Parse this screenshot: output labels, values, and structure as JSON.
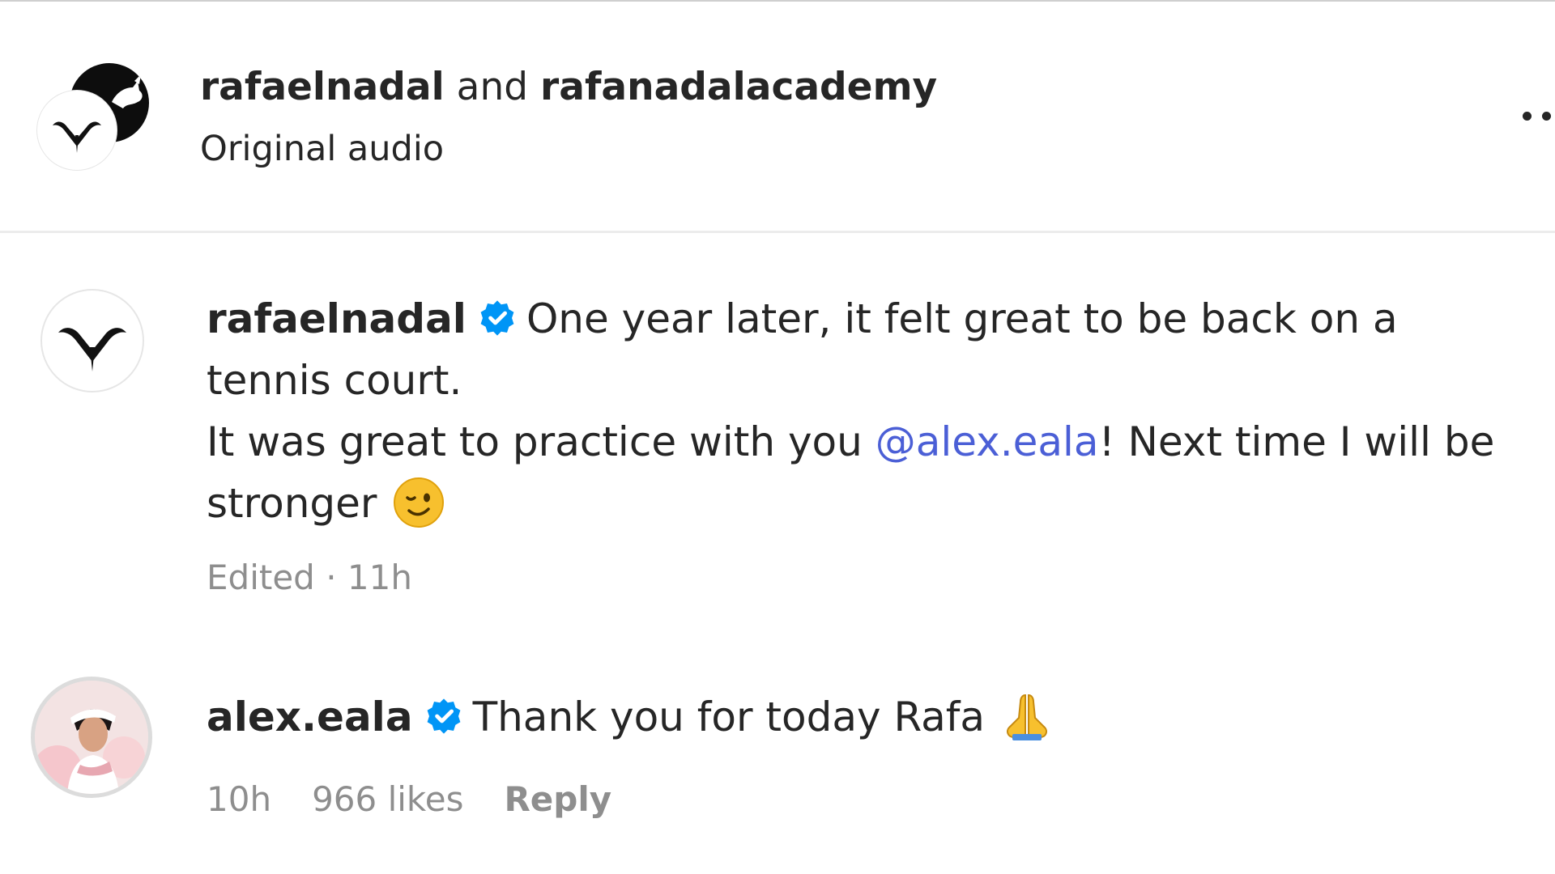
{
  "header": {
    "author_primary": "rafaelnadal",
    "joiner": "and",
    "author_secondary": "rafanadalacademy",
    "audio_label": "Original audio",
    "more_icon": "more-horizontal-icon"
  },
  "comments": [
    {
      "username": "rafaelnadal",
      "verified": true,
      "text_part1": "One year later, it felt great to be back on a tennis court.",
      "text_part2": "It was great to practice with you ",
      "mention": "@alex.eala",
      "text_part3": "! Next time I will be stronger",
      "emoji_icon": "winking-face-emoji",
      "edited_label": "Edited",
      "separator": "·",
      "time": "11h"
    },
    {
      "username": "alex.eala",
      "verified": true,
      "text": "Thank you for today Rafa",
      "emoji_icon": "folded-hands-emoji",
      "time": "10h",
      "likes": "966 likes",
      "reply_label": "Reply"
    }
  ],
  "colors": {
    "text": "#262626",
    "muted": "#8e8e8e",
    "mention": "#4b5fd6",
    "verified": "#0095f6"
  }
}
